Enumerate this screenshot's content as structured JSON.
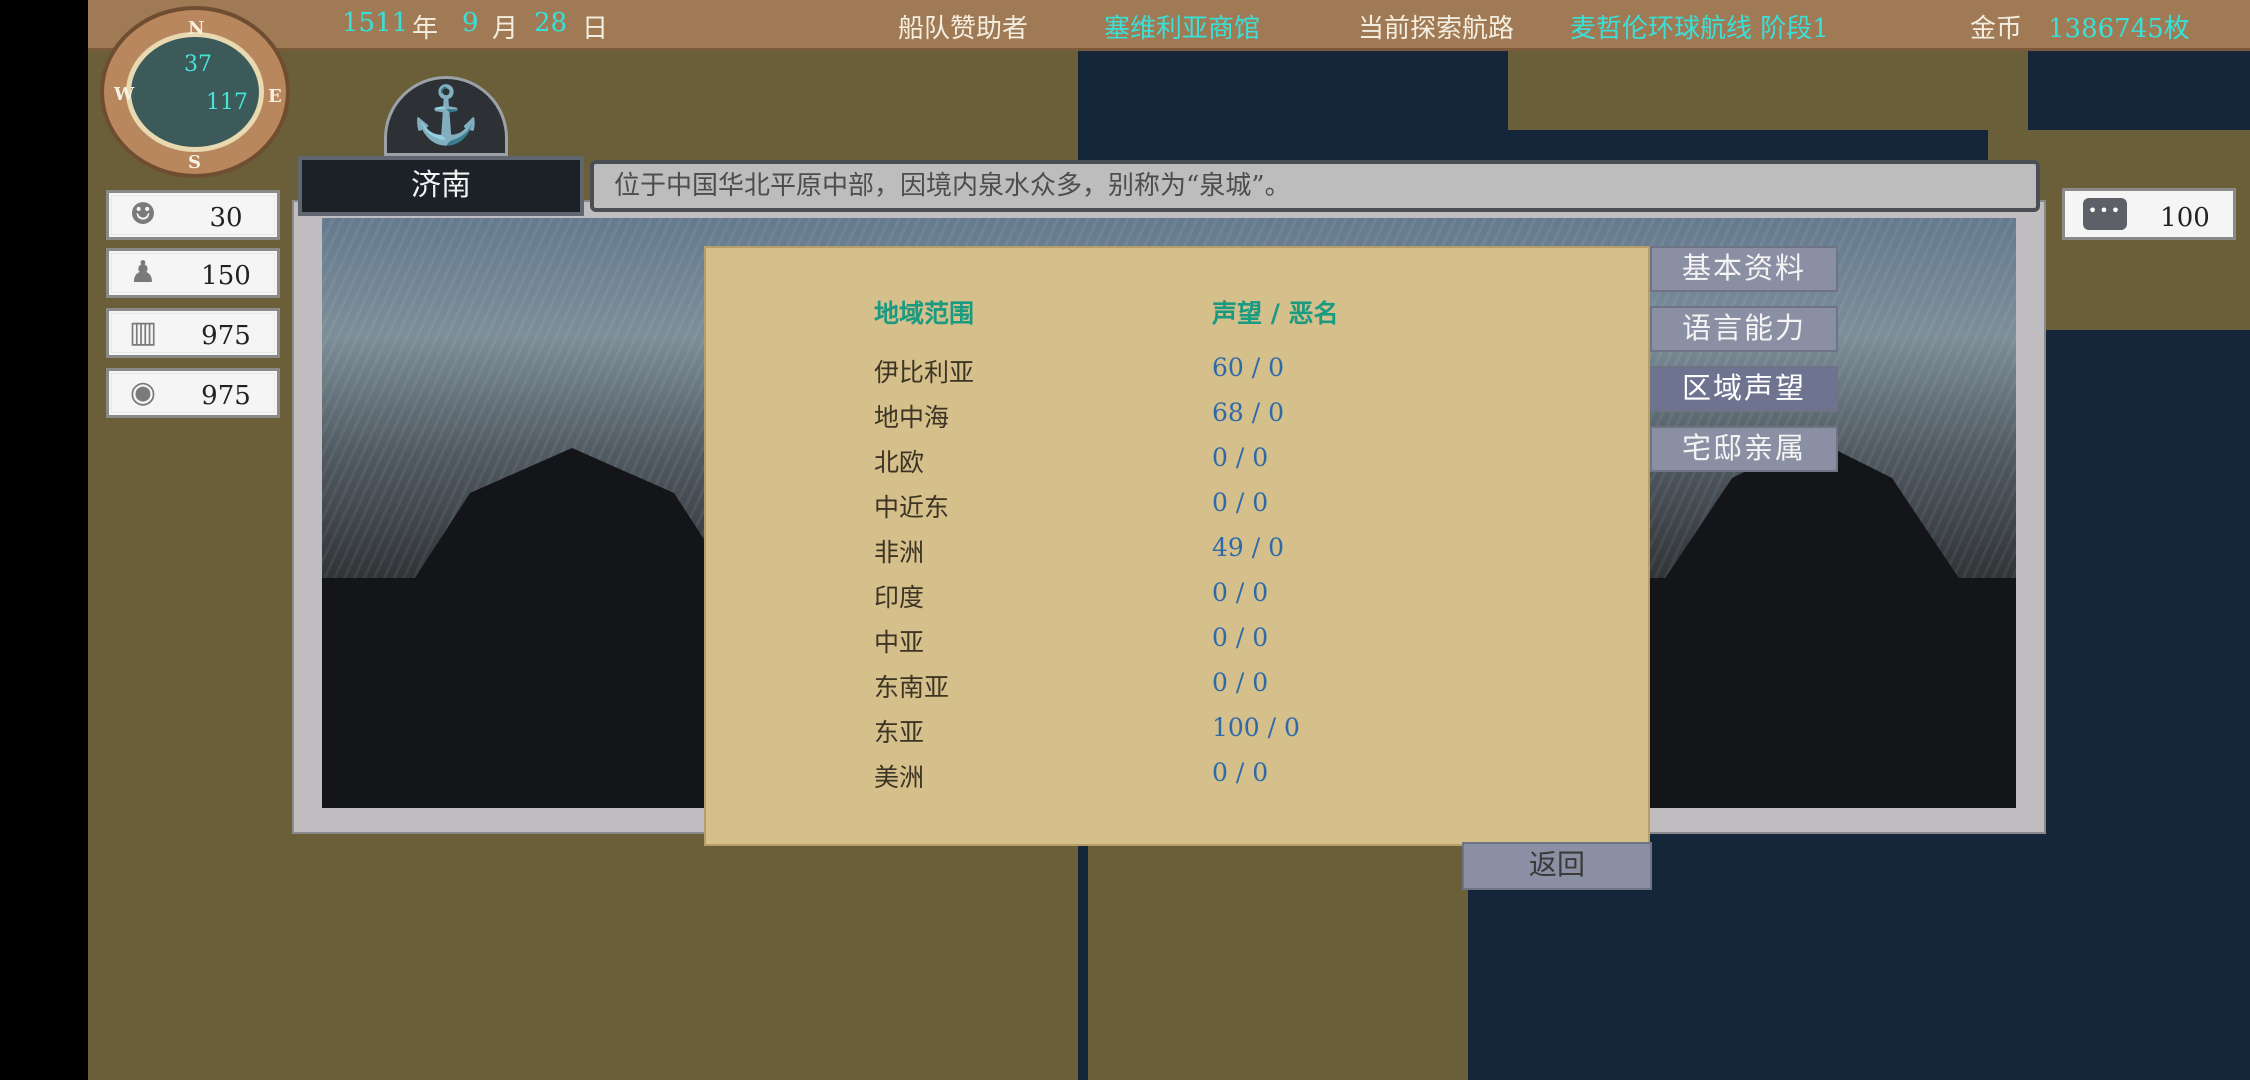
{
  "topbar": {
    "year": "1511",
    "year_unit": "年",
    "month": "9",
    "month_unit": "月",
    "day": "28",
    "day_unit": "日",
    "sponsor_label": "船队赞助者",
    "sponsor_value": "塞维利亚商馆",
    "route_label": "当前探索航路",
    "route_value": "麦哲伦环球航线 阶段1",
    "gold_label": "金币",
    "gold_value": "1386745枚"
  },
  "compass": {
    "n": "N",
    "s": "S",
    "e": "E",
    "w": "W",
    "value_top": "37",
    "value_bottom": "117"
  },
  "stats": [
    {
      "icon": "sailor-icon",
      "value": "30"
    },
    {
      "icon": "person-icon",
      "value": "150"
    },
    {
      "icon": "barrel-icon",
      "value": "975"
    },
    {
      "icon": "food-icon",
      "value": "975"
    }
  ],
  "chat": {
    "icon": "chat-icon",
    "dots": "•••",
    "value": "100"
  },
  "city": {
    "name": "济南",
    "description": "位于中国华北平原中部，因境内泉水众多，别称为“泉城”。"
  },
  "reputation": {
    "header_region": "地域范围",
    "header_value": "声望 / 恶名",
    "rows": [
      {
        "name": "伊比利亚",
        "value": "60 / 0"
      },
      {
        "name": "地中海",
        "value": "68 / 0"
      },
      {
        "name": "北欧",
        "value": "0 / 0"
      },
      {
        "name": "中近东",
        "value": "0 / 0"
      },
      {
        "name": "非洲",
        "value": "49 / 0"
      },
      {
        "name": "印度",
        "value": "0 / 0"
      },
      {
        "name": "中亚",
        "value": "0 / 0"
      },
      {
        "name": "东南亚",
        "value": "0 / 0"
      },
      {
        "name": "东亚",
        "value": "100 / 0"
      },
      {
        "name": "美洲",
        "value": "0 / 0"
      }
    ]
  },
  "tabs": [
    {
      "label": "基本资料"
    },
    {
      "label": "语言能力"
    },
    {
      "label": "区域声望"
    },
    {
      "label": "宅邸亲属"
    }
  ],
  "back_label": "返回",
  "colors": {
    "accent_cyan": "#39e0d8",
    "header_teal": "#1a9a80",
    "value_blue": "#2e6aa8",
    "panel_bg": "#d5bf8b"
  }
}
